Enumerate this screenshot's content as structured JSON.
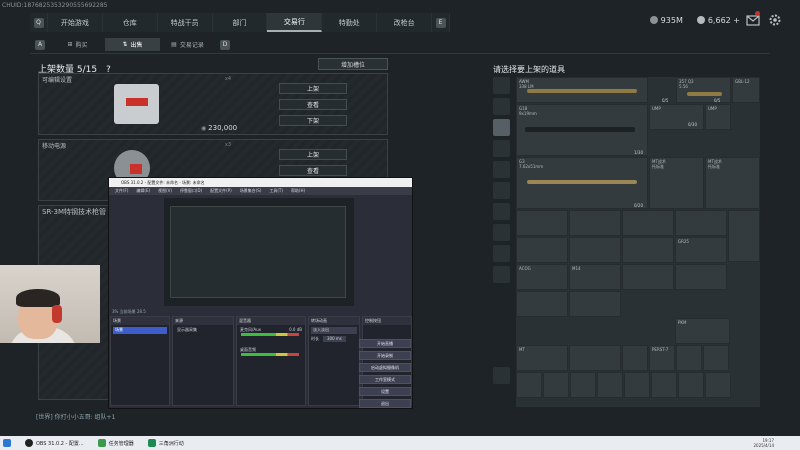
{
  "uid": "CHUID:1876825353290555692285",
  "nav": {
    "left_key": "Q",
    "right_key": "E",
    "tabs": [
      "开始游戏",
      "仓库",
      "特战干员",
      "部门",
      "交易行",
      "特勤处",
      "改枪台"
    ],
    "active": "交易行"
  },
  "currency": {
    "coins": "935M",
    "tokens": "6,662 +"
  },
  "subnav": {
    "left_key": "A",
    "right_key": "D",
    "tabs": [
      "购买",
      "出售",
      "交易记录"
    ],
    "active": "出售"
  },
  "listing": {
    "title": "上架数量 5/15",
    "help": "?",
    "add_slot": "增加槽位",
    "slots": [
      {
        "label": "可编辑设置",
        "index": "x4",
        "buttons": [
          "上架",
          "查看",
          "下架"
        ],
        "price": "230,000"
      },
      {
        "label": "移动电源",
        "index": "x3",
        "buttons": [
          "上架",
          "查看"
        ],
        "price": ""
      },
      {
        "label": "SR-3M特钢技术枪管",
        "index": "",
        "buttons": [],
        "price": ""
      }
    ]
  },
  "chat": "[世界] 你打小小五哥: 组队+1",
  "right_panel": {
    "title": "请选择要上架的道具",
    "items": [
      {
        "name": "AWM",
        "sub": "338 LM"
      },
      {
        "name": "357 Q3",
        "sub": "5.56"
      },
      {
        "name": "GBL-12",
        "sub": ""
      },
      {
        "name": "G18",
        "sub": "9x19mm"
      },
      {
        "name": "UMP",
        "sub": ""
      },
      {
        "name": "UMP",
        "sub": ""
      },
      {
        "name": "G3",
        "sub": "7.62x51mm"
      },
      {
        "name": "MT战术",
        "sub": "托标准"
      },
      {
        "name": "MT战术",
        "sub": "托标准"
      },
      {
        "name": "GR25",
        "sub": ""
      },
      {
        "name": "ACOG",
        "sub": ""
      },
      {
        "name": "M14",
        "sub": ""
      },
      {
        "name": "PKM",
        "sub": ""
      },
      {
        "name": "MT",
        "sub": ""
      },
      {
        "name": "PERST-7",
        "sub": ""
      }
    ],
    "counters": [
      "0/5",
      "0/5",
      "0/30",
      "1/30",
      "0/20"
    ]
  },
  "obs": {
    "title": "OBS 31.0.2 - 配置文件: 未命名 - 场景: 未命名",
    "menu": [
      "文件(F)",
      "编辑(E)",
      "视图(V)",
      "停靠窗口(D)",
      "配置文件(P)",
      "场景集合(S)",
      "工具(T)",
      "帮助(H)"
    ],
    "status": "3% 当前场景 28.5",
    "docks": {
      "scenes": {
        "title": "场景",
        "item": "场景"
      },
      "sources": {
        "title": "来源",
        "item": "显示器采集"
      },
      "mixer": {
        "title": "混音器",
        "ch1": "麦克风/Aux",
        "ch2": "桌面音频",
        "db": "0.0 dB"
      },
      "transitions": {
        "title": "转场动画",
        "type": "淡入淡出",
        "duration_label": "时长",
        "duration": "300 ms"
      },
      "controls": {
        "title": "控制按钮",
        "buttons": [
          "开始直播",
          "开始录制",
          "启动虚拟摄像机",
          "工作室模式",
          "设置",
          "退出"
        ]
      }
    }
  },
  "taskbar": {
    "apps": [
      "OBS 31.0.2 - 配置...",
      "任务管理器",
      "三角洲行动"
    ],
    "clock_time": "19:17",
    "clock_date": "2025/4/14"
  }
}
